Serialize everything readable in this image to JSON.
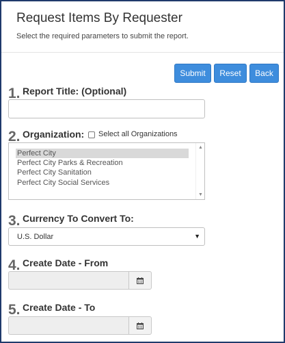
{
  "header": {
    "title": "Request Items By Requester",
    "subtitle": "Select the required parameters to submit the report."
  },
  "toolbar": {
    "submit_label": "Submit",
    "reset_label": "Reset",
    "back_label": "Back",
    "button_color": "#3e8ddd"
  },
  "steps": {
    "report_title": {
      "number": "1.",
      "label": "Report Title: (Optional)",
      "value": ""
    },
    "organization": {
      "number": "2.",
      "label": "Organization:",
      "select_all_label": "Select all Organizations",
      "select_all_checked": false,
      "options": [
        "Perfect City",
        "Perfect City Parks & Recreation",
        "Perfect City Sanitation",
        "Perfect City Social Services"
      ],
      "selected_option": "Perfect City"
    },
    "currency": {
      "number": "3.",
      "label": "Currency To Convert To:",
      "selected": "U.S. Dollar"
    },
    "date_from": {
      "number": "4.",
      "label": "Create Date - From",
      "value": "",
      "icon": "calendar-icon"
    },
    "date_to": {
      "number": "5.",
      "label": "Create Date - To",
      "value": "",
      "icon": "calendar-icon"
    }
  }
}
